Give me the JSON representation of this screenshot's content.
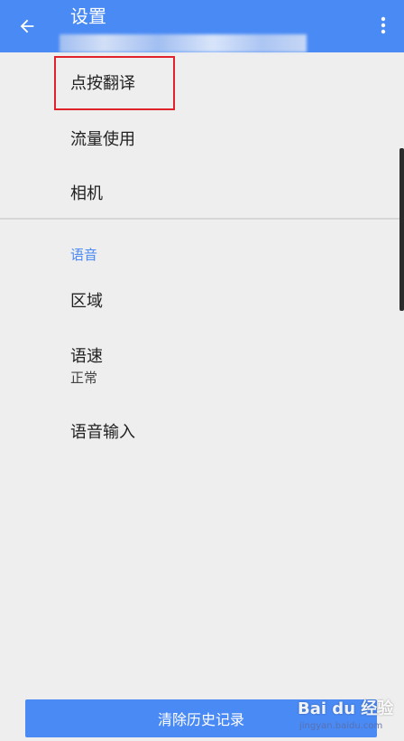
{
  "header": {
    "title": "设置",
    "back_icon": "arrow-left-icon",
    "menu_icon": "more-vertical-icon",
    "bg_color": "#4a8af4"
  },
  "settings": {
    "tap_to_translate": "点按翻译",
    "data_usage": "流量使用",
    "camera": "相机",
    "voice_section": "语音",
    "region": "区域",
    "speech_rate": "语速",
    "speech_rate_value": "正常",
    "voice_input": "语音输入"
  },
  "footer": {
    "clear_history": "清除历史记录"
  },
  "watermark": {
    "brand": "Bai du 经验",
    "url": "jingyan.baidu.com"
  },
  "colors": {
    "accent": "#4a8af4",
    "highlight": "#e0232b",
    "background": "#eeeeee"
  }
}
